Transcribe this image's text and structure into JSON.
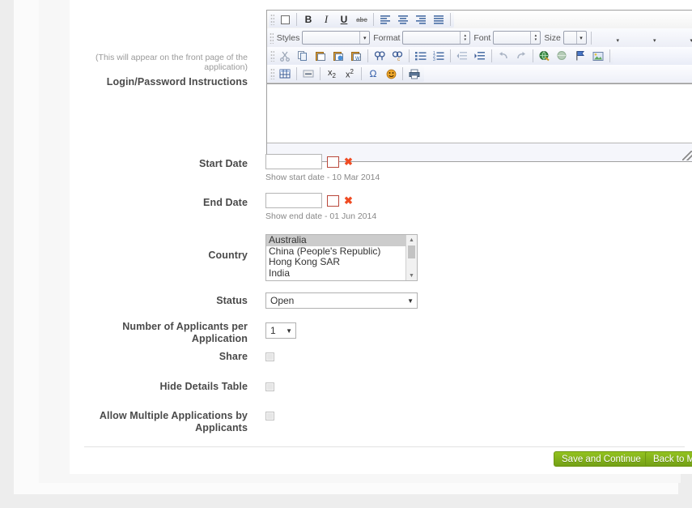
{
  "editor": {
    "toolbar_rows": [
      {
        "name": "basic-styles-row",
        "buttons": [
          {
            "name": "maximize-icon",
            "label": "Maximize"
          },
          {
            "name": "bold-icon",
            "label": "B"
          },
          {
            "name": "italic-icon",
            "label": "I"
          },
          {
            "name": "underline-icon",
            "label": "U"
          },
          {
            "name": "strikethrough-icon",
            "label": "abc"
          },
          {
            "name": "align-left-icon",
            "label": "Align Left"
          },
          {
            "name": "align-center-icon",
            "label": "Center"
          },
          {
            "name": "align-right-icon",
            "label": "Align Right"
          },
          {
            "name": "justify-icon",
            "label": "Justify"
          }
        ]
      },
      {
        "name": "styles-row",
        "selects": [
          {
            "name": "styles-select",
            "label": "Styles",
            "value": ""
          },
          {
            "name": "format-select",
            "label": "Format",
            "value": ""
          },
          {
            "name": "font-select",
            "label": "Font",
            "value": ""
          },
          {
            "name": "size-select",
            "label": "Size",
            "value": ""
          }
        ]
      },
      {
        "name": "clipboard-row",
        "buttons": [
          {
            "name": "cut-icon",
            "label": "Cut"
          },
          {
            "name": "copy-icon",
            "label": "Copy"
          },
          {
            "name": "paste-icon",
            "label": "Paste"
          },
          {
            "name": "paste-text-icon",
            "label": "Paste as plain text"
          },
          {
            "name": "paste-word-icon",
            "label": "Paste from Word"
          },
          {
            "name": "find-icon",
            "label": "Find"
          },
          {
            "name": "replace-icon",
            "label": "Replace"
          },
          {
            "name": "bulleted-list-icon",
            "label": "Insert/Remove Bulleted List"
          },
          {
            "name": "numbered-list-icon",
            "label": "Insert/Remove Numbered List"
          },
          {
            "name": "outdent-icon",
            "label": "Decrease Indent"
          },
          {
            "name": "indent-icon",
            "label": "Increase Indent"
          },
          {
            "name": "undo-icon",
            "label": "Undo"
          },
          {
            "name": "redo-icon",
            "label": "Redo"
          },
          {
            "name": "link-icon",
            "label": "Link"
          },
          {
            "name": "unlink-icon",
            "label": "Unlink"
          },
          {
            "name": "anchor-icon",
            "label": "Anchor"
          },
          {
            "name": "image-icon",
            "label": "Image"
          }
        ]
      },
      {
        "name": "insert-row",
        "buttons": [
          {
            "name": "table-icon",
            "label": "Table"
          },
          {
            "name": "horizontal-rule-icon",
            "label": "Horizontal Line"
          },
          {
            "name": "subscript-icon",
            "label": "x2"
          },
          {
            "name": "superscript-icon",
            "label": "x2"
          },
          {
            "name": "special-char-icon",
            "label": "Ω"
          },
          {
            "name": "smiley-icon",
            "label": "Smiley"
          },
          {
            "name": "print-icon",
            "label": "Print"
          }
        ]
      }
    ],
    "content": ""
  },
  "fields": {
    "instructions": {
      "hint": "(This will appear on the front page of the application)",
      "label": "Login/Password Instructions"
    },
    "start_date": {
      "label": "Start Date",
      "value": "",
      "hint": "Show start date - 10 Mar 2014",
      "calendar_icon": "calendar-icon",
      "clear_icon": "clear-date-icon"
    },
    "end_date": {
      "label": "End Date",
      "value": "",
      "hint": "Show end date - 01 Jun 2014",
      "calendar_icon": "calendar-icon",
      "clear_icon": "clear-date-icon"
    },
    "country": {
      "label": "Country",
      "options": [
        "Australia",
        "China (People's Republic)",
        "Hong Kong SAR",
        "India"
      ],
      "selected": "Australia"
    },
    "status": {
      "label": "Status",
      "value": "Open"
    },
    "applicants_per_application": {
      "label": "Number of Applicants per Application",
      "value": "1"
    },
    "share": {
      "label": "Share",
      "checked": false
    },
    "hide_details_table": {
      "label": "Hide Details Table",
      "checked": false
    },
    "allow_multiple": {
      "label": "Allow Multiple Applications by Applicants",
      "checked": false
    }
  },
  "footer": {
    "save_label": "Save and Continue",
    "back_label": "Back to My Shows"
  },
  "colors": {
    "button_green_top": "#93c21f",
    "button_green_bottom": "#73a016",
    "accent_red": "#ef4b23",
    "page_background": "#ededed"
  }
}
